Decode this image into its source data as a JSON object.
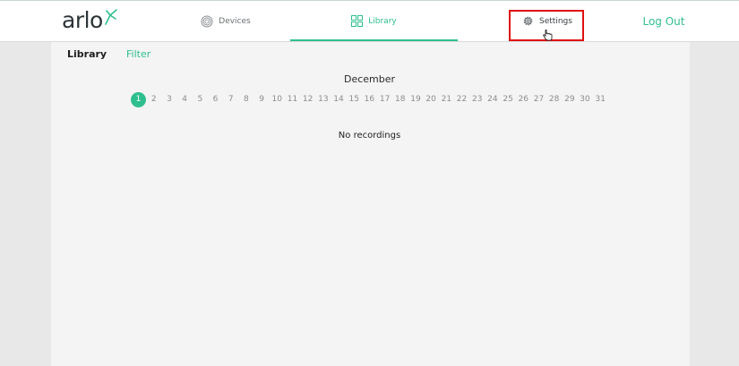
{
  "brand": {
    "logo_text": "arlo"
  },
  "nav": {
    "devices_label": "Devices",
    "library_label": "Library",
    "settings_label": "Settings",
    "logout_label": "Log Out"
  },
  "library": {
    "title": "Library",
    "filter_label": "Filter",
    "month": "December",
    "days": [
      "1",
      "2",
      "3",
      "4",
      "5",
      "6",
      "7",
      "8",
      "9",
      "10",
      "11",
      "12",
      "13",
      "14",
      "15",
      "16",
      "17",
      "18",
      "19",
      "20",
      "21",
      "22",
      "23",
      "24",
      "25",
      "26",
      "27",
      "28",
      "29",
      "30",
      "31"
    ],
    "selected_day": "1",
    "empty_message": "No recordings"
  },
  "colors": {
    "accent": "#2fbf8f",
    "highlight": "#e01111"
  },
  "icons": {
    "devices": "devices-icon",
    "library": "grid-icon",
    "settings": "gear-icon",
    "cursor": "hand-pointer-icon"
  }
}
